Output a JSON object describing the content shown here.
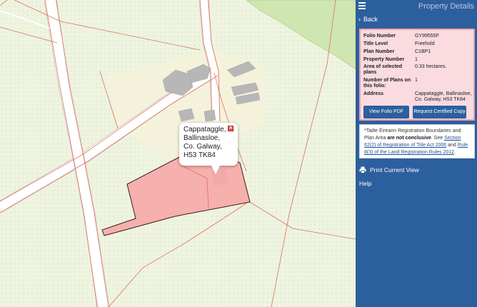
{
  "panel": {
    "title": "Property Details",
    "back_label": "Back",
    "icons": {
      "menu": "hamburger-menu-icon",
      "back": "chevron-right-icon",
      "print": "printer-icon",
      "close": "close-icon"
    }
  },
  "folio": {
    "rows": [
      {
        "key": "Folio Number",
        "value": "GY99555F"
      },
      {
        "key": "Title Level",
        "value": "Freehold"
      },
      {
        "key": "Plan Number",
        "value": "C1BP1"
      },
      {
        "key": "Property Number",
        "value": "1"
      },
      {
        "key": "Area of selected plans",
        "value": "0.33 hectares."
      },
      {
        "key": "Number of Plans on this folio:",
        "value": "1"
      },
      {
        "key": "Address",
        "value": "Cappataggle, Ballinasloe, Co. Galway, H53 TK84"
      }
    ],
    "view_pdf_label": "View Folio PDF",
    "certified_copy_label": "Request Certified Copy"
  },
  "notice": {
    "intro": "*Tailte Éireann Registration Boundaries and Plan Area",
    "emphasis": "are not conclusive",
    "see": ". See",
    "link1": "Section 62(2) of Registration of Title Act 2006",
    "and": "and",
    "link2": "Rule 8(3) of the Land Registration Rules 2012",
    "end": "."
  },
  "actions": {
    "print_label": "Print Current View",
    "help_label": "Help"
  },
  "map": {
    "popup_lines": [
      "Cappataggle,",
      "Ballinasloe,",
      "Co. Galway,",
      "H53 TK84"
    ],
    "colors": {
      "field": "#eef4df",
      "green_area": "#cfe6b0",
      "parcel_fill": "#f6a8a8",
      "parcel_outline": "#3a1a1a",
      "boundary": "#e07060",
      "road": "#ffffff",
      "building": "#b7b7b7",
      "yard": "#f5f2dc"
    }
  }
}
